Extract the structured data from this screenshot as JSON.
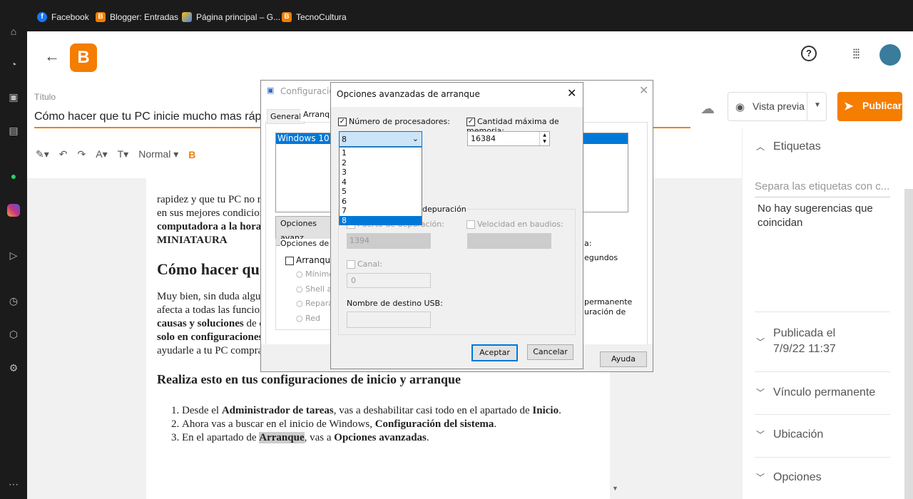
{
  "bookmarks": [
    {
      "label": "Facebook",
      "icon": "facebook-icon",
      "color": "#1877f2"
    },
    {
      "label": "Blogger: Entradas",
      "icon": "blogger-icon",
      "color": "#f57d00"
    },
    {
      "label": "Página principal – G...",
      "icon": "google-ads-icon",
      "color": "#fbbc04"
    },
    {
      "label": "TecnoCultura",
      "icon": "blogger-icon",
      "color": "#f57d00"
    }
  ],
  "sidebar_icons": [
    "gamepad-icon",
    "speedometer-icon",
    "bag-icon",
    "twitch-icon",
    "whatsapp-icon",
    "instagram-icon",
    "play-icon",
    "clock-icon",
    "cube-icon",
    "gear-icon",
    "more-icon"
  ],
  "header": {
    "title_label": "Título",
    "title_value": "Cómo hacer que tu PC inicie mucho mas rápido",
    "preview": "Vista previa",
    "publish": "Publicar",
    "brand_color": "#f57d00"
  },
  "toolbar": {
    "format": "Normal"
  },
  "doc": {
    "p1": [
      "rapidez y que tu PC no r",
      "en sus mejores condicion"
    ],
    "p1_bold": [
      "computadora a la hora",
      "MINIATAURA"
    ],
    "h2": "Cómo hacer qu",
    "p2": "Muy bien, sin duda algu",
    "p2b": "afecta a todas las funcion",
    "p2c_bold": "causas y soluciones",
    "p2c": " de c",
    "p2d_bold": "solo en configuraciones",
    "p2e": "ayudarle a tu PC compra",
    "h3": "Realiza esto en tus configuraciones de inicio y arranque",
    "list": [
      {
        "a": "Desde el ",
        "b": "Administrador de tareas",
        "c": ", vas a deshabilitar casi todo en el apartado de ",
        "d": "Inicio",
        "e": "."
      },
      {
        "a": "Ahora vas a buscar en el inicio de Windows, ",
        "b": "Configuración del sistema",
        "c": ".",
        "d": "",
        "e": ""
      },
      {
        "a": "En el apartado de ",
        "b": "Arranque",
        "c": ", vas a ",
        "d": "Opciones avanzadas",
        "e": "."
      }
    ]
  },
  "side": {
    "labels": "Etiquetas",
    "labels_placeholder": "Separa las etiquetas con c...",
    "no_suggestions": "No hay sugerencias que coincidan",
    "published": "Publicada el",
    "published_date": "7/9/22 11:37",
    "permalink": "Vínculo permanente",
    "location": "Ubicación",
    "options": "Opciones"
  },
  "sysconfig": {
    "title": "Configuración",
    "tabs": [
      "General",
      "Arranque"
    ],
    "entry": "Windows 10 (C:\\",
    "advanced_btn": "Opciones avanz",
    "boot_opts": "Opciones de arr",
    "safe_boot": "Arranque a",
    "radios": [
      "Mínimo",
      "Shell alt",
      "Reparar",
      "Red"
    ],
    "right_a": "a:",
    "right_b": "egundos",
    "right_c": "permanente",
    "right_d": "uración de",
    "help": "Ayuda"
  },
  "adv": {
    "title": "Opciones avanzadas de arranque",
    "num_proc": "Número de procesadores:",
    "num_proc_value": "8",
    "proc_options": [
      "1",
      "2",
      "3",
      "4",
      "5",
      "6",
      "7",
      "8"
    ],
    "max_mem": "Cantidad máxima de memoria:",
    "max_mem_value": "16384",
    "debug_group": "depuración",
    "debug_port": "Puerto de depuración:",
    "debug_port_value": "1394",
    "baud": "Velocidad en baudios:",
    "channel": "Canal:",
    "channel_value": "0",
    "usb": "Nombre de destino USB:",
    "ok": "Aceptar",
    "cancel": "Cancelar"
  }
}
